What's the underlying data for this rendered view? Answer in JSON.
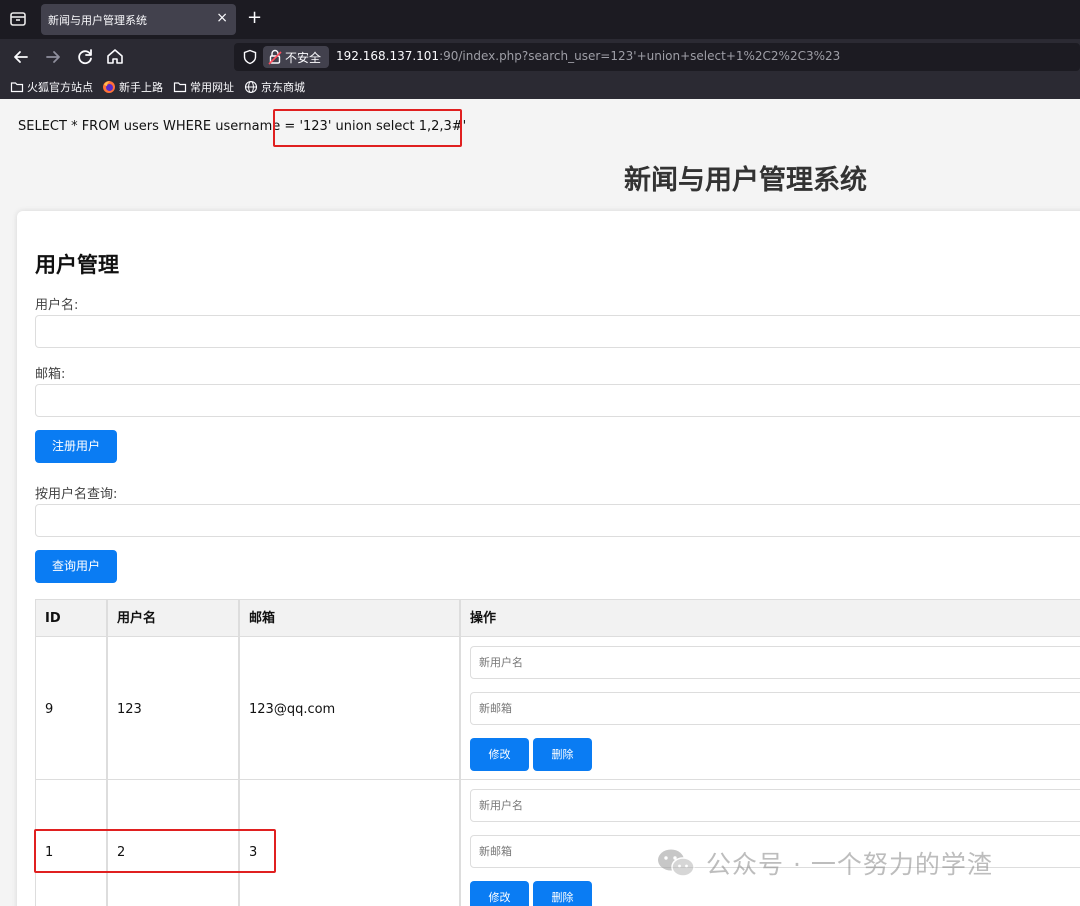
{
  "browser": {
    "tab_title": "新闻与用户管理系统",
    "tab_close": "×",
    "new_tab": "+",
    "insecure_label": "不安全",
    "url_host": "192.168.137.101",
    "url_path": ":90/index.php?search_user=123'+union+select+1%2C2%2C3%23",
    "bookmarks": [
      {
        "label": "火狐官方站点",
        "icon": "folder-icon"
      },
      {
        "label": "新手上路",
        "icon": "firefox-icon"
      },
      {
        "label": "常用网址",
        "icon": "folder-icon"
      },
      {
        "label": "京东商城",
        "icon": "globe-icon"
      }
    ]
  },
  "page": {
    "sql_prefix": "SELECT * FROM users WHERE username = ",
    "sql_injected": "'123' union select 1,2,3#'",
    "site_title": "新闻与用户管理系统",
    "section_title": "用户管理",
    "username_label": "用户名:",
    "email_label": "邮箱:",
    "register_button": "注册用户",
    "search_label": "按用户名查询:",
    "search_button": "查询用户",
    "table": {
      "headers": [
        "ID",
        "用户名",
        "邮箱",
        "操作"
      ],
      "rows": [
        {
          "id": "9",
          "username": "123",
          "email": "123@qq.com"
        },
        {
          "id": "1",
          "username": "2",
          "email": "3"
        }
      ],
      "new_username_placeholder": "新用户名",
      "new_email_placeholder": "新邮箱",
      "edit_button": "修改",
      "delete_button": "删除"
    },
    "watermark": "公众号 · 一个努力的学渣"
  },
  "colors": {
    "accent": "#0a7cf3",
    "highlight": "#e02020"
  }
}
